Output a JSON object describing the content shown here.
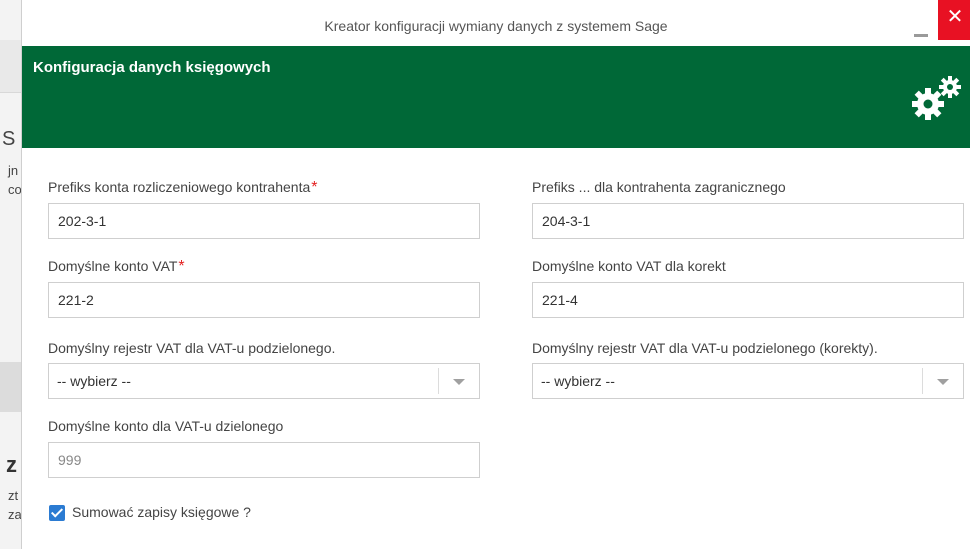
{
  "window": {
    "title": "Kreator konfiguracji wymiany danych z systemem Sage",
    "close_glyph": "✕"
  },
  "background_window": {
    "fragments": [
      "S",
      "jn",
      "co",
      "z",
      "zt",
      "za"
    ]
  },
  "header": {
    "title": "Konfiguracja danych księgowych",
    "icon": "gears-icon",
    "background_color": "#006837"
  },
  "form": {
    "required_mark": "*",
    "prefix_settlement": {
      "label": "Prefiks konta rozliczeniowego kontrahenta",
      "value": "202-3-1",
      "required": true
    },
    "prefix_foreign": {
      "label": "Prefiks ... dla kontrahenta zagranicznego",
      "value": "204-3-1"
    },
    "default_vat_account": {
      "label": "Domyślne konto VAT",
      "value": "221-2",
      "required": true
    },
    "default_vat_correction": {
      "label": "Domyślne konto VAT dla korekt",
      "value": "221-4"
    },
    "vat_register_split": {
      "label": "Domyślny rejestr VAT dla VAT-u podzielonego.",
      "selected": "-- wybierz --"
    },
    "vat_register_split_correction": {
      "label": "Domyślny rejestr VAT dla VAT-u podzielonego (korekty).",
      "selected": "-- wybierz --"
    },
    "split_vat_account": {
      "label": "Domyślne konto dla VAT-u dzielonego",
      "placeholder": "999"
    },
    "sum_entries": {
      "label": "Sumować zapisy księgowe ?",
      "checked": true,
      "color": "#2b7bd2"
    }
  }
}
